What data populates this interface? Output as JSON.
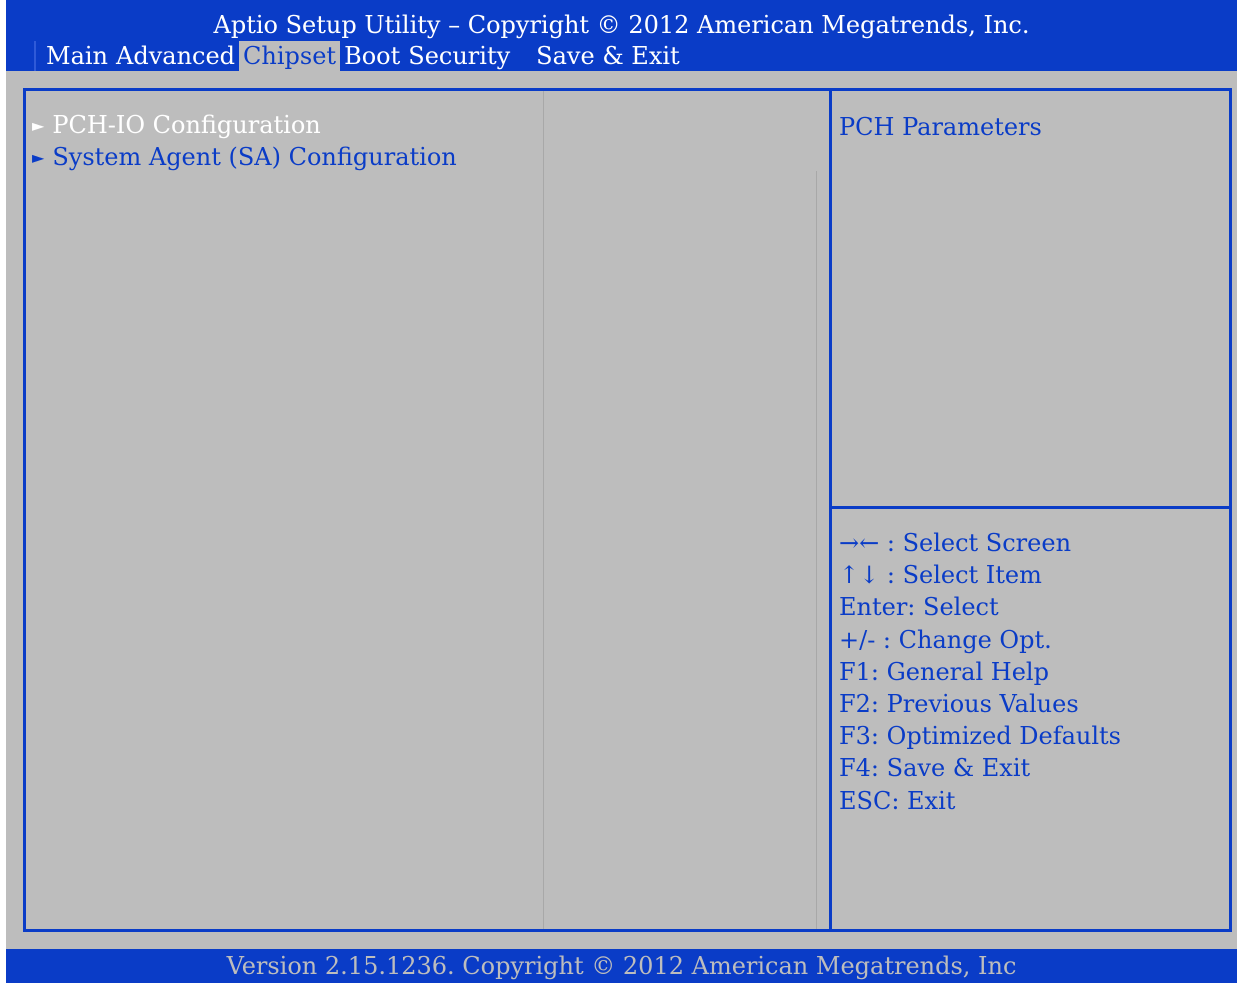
{
  "header": {
    "title": "Aptio Setup Utility – Copyright © 2012 American Megatrends, Inc.",
    "tabs": [
      {
        "label": "Main"
      },
      {
        "label": "Advanced"
      },
      {
        "label": "Chipset"
      },
      {
        "label": "Boot"
      },
      {
        "label": "Security"
      },
      {
        "label": "Save & Exit"
      }
    ],
    "active_tab": "Chipset"
  },
  "menu": {
    "arrow": "►",
    "items": [
      {
        "label": "PCH-IO Configuration",
        "selected": true
      },
      {
        "label": "System Agent (SA) Configuration",
        "selected": false
      }
    ]
  },
  "help": {
    "text": "PCH Parameters"
  },
  "keys": [
    "→← : Select Screen",
    "↑↓ : Select Item",
    "Enter: Select",
    "+/- : Change Opt.",
    "F1: General Help",
    "F2: Previous Values",
    "F3: Optimized Defaults",
    "F4: Save & Exit",
    "ESC: Exit"
  ],
  "footer": {
    "text": "Version 2.15.1236. Copyright © 2012 American Megatrends, Inc"
  },
  "colors": {
    "bios_blue": "#0a3cc7",
    "panel_gray": "#bdbdbd",
    "selected_text": "#ffffff"
  }
}
